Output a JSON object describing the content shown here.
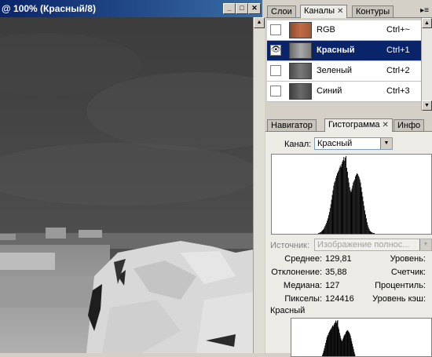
{
  "document": {
    "title": "@ 100% (Красный/8)",
    "controls": {
      "minimize": "_",
      "maximize": "□",
      "close": "✕"
    }
  },
  "channels_palette": {
    "tabs": [
      {
        "label": "Слои",
        "active": false
      },
      {
        "label": "Каналы",
        "active": true,
        "close": "✕"
      },
      {
        "label": "Контуры",
        "active": false
      }
    ],
    "menu_icon": "▸≡",
    "channels": [
      {
        "name": "RGB",
        "shortcut": "Ctrl+~",
        "visible": false,
        "selected": false,
        "thumb": "rgb"
      },
      {
        "name": "Красный",
        "shortcut": "Ctrl+1",
        "visible": true,
        "selected": true,
        "thumb": "red"
      },
      {
        "name": "Зеленый",
        "shortcut": "Ctrl+2",
        "visible": false,
        "selected": false,
        "thumb": "green"
      },
      {
        "name": "Синий",
        "shortcut": "Ctrl+3",
        "visible": false,
        "selected": false,
        "thumb": "blue"
      }
    ],
    "eye_icon": "👁"
  },
  "histogram_palette": {
    "tabs": [
      {
        "label": "Навигатор",
        "active": false
      },
      {
        "label": "Гистограмма",
        "active": true,
        "close": "✕"
      },
      {
        "label": "Инфо",
        "active": false
      }
    ],
    "channel_label": "Канал:",
    "channel_value": "Красный",
    "source_label": "Источник:",
    "source_value": "Изображение полнос...",
    "stats_left": [
      {
        "label": "Среднее:",
        "value": "129,81"
      },
      {
        "label": "Отклонение:",
        "value": "35,88"
      },
      {
        "label": "Медиана:",
        "value": "127"
      },
      {
        "label": "Пикселы:",
        "value": "124416"
      }
    ],
    "stats_right": [
      {
        "label": "Уровень:"
      },
      {
        "label": "Счетчик:"
      },
      {
        "label": "Процентиль:"
      },
      {
        "label": "Уровень кэш:"
      }
    ],
    "second_channel_label": "Красный"
  },
  "histogram_data": {
    "bins": [
      0,
      0,
      0,
      0,
      0,
      0,
      0,
      0,
      0,
      0,
      0,
      0,
      0,
      0,
      0,
      0,
      0,
      0,
      0,
      0,
      0,
      0,
      0,
      0,
      0,
      0,
      0,
      0,
      0,
      0,
      0,
      0,
      0,
      0,
      0,
      0,
      0,
      0,
      0,
      0,
      0,
      0,
      0,
      0,
      0,
      0,
      0,
      0,
      0,
      0,
      0,
      0,
      0,
      0,
      0,
      0,
      0,
      0,
      0,
      0,
      0,
      0,
      0,
      0,
      1,
      1,
      2,
      2,
      3,
      4,
      5,
      6,
      8,
      10,
      12,
      14,
      17,
      20,
      24,
      28,
      33,
      38,
      44,
      50,
      56,
      62,
      66,
      68,
      72,
      75,
      78,
      80,
      82,
      85,
      88,
      86,
      90,
      93,
      95,
      99,
      94,
      98,
      100,
      85,
      80,
      72,
      66,
      60,
      56,
      54,
      58,
      62,
      66,
      68,
      70,
      74,
      76,
      78,
      77,
      75,
      73,
      70,
      66,
      60,
      54,
      48,
      42,
      36,
      30,
      25,
      20,
      15,
      11,
      8,
      6,
      4,
      3,
      2,
      2,
      1,
      1,
      1,
      0,
      0,
      0,
      0,
      0,
      0,
      0,
      0,
      0,
      0,
      0,
      0,
      0,
      0,
      0,
      0,
      0,
      0,
      0,
      0,
      0,
      0,
      0,
      0,
      0,
      0,
      0,
      0,
      0,
      0,
      0,
      0,
      0,
      0,
      0,
      0,
      0,
      0,
      0,
      0,
      0,
      0,
      0,
      0,
      0,
      0,
      0,
      0,
      0,
      0,
      0,
      0,
      0,
      0,
      0,
      0,
      0,
      0,
      0,
      0,
      0,
      0,
      0,
      0,
      0,
      0,
      0,
      0,
      0,
      0,
      0,
      0,
      0,
      0,
      0,
      0,
      0,
      0
    ]
  },
  "colors": {
    "title_bar": "#0a246a",
    "selection": "#0a246a",
    "panel": "#d4d0c8",
    "histogram_fill": "#000000"
  }
}
